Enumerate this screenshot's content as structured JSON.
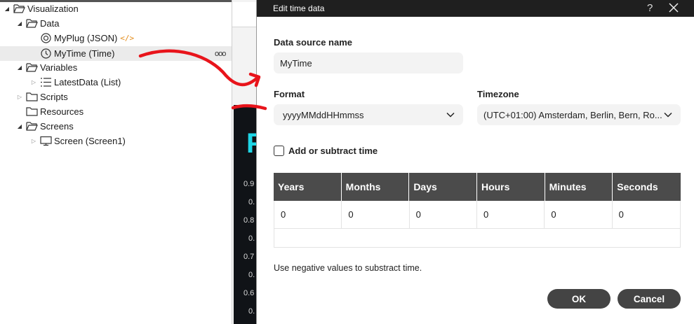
{
  "tree": {
    "root": "Visualization",
    "data": "Data",
    "myplug": "MyPlug (JSON)",
    "myplug_tag": "</>",
    "mytime": "MyTime (Time)",
    "more": "ooo",
    "variables": "Variables",
    "latestdata": "LatestData (List)",
    "scripts": "Scripts",
    "resources": "Resources",
    "screens": "Screens",
    "screen1": "Screen (Screen1)"
  },
  "background": {
    "ticks": [
      "0.9",
      "0.",
      "0.8",
      "0.",
      "0.7",
      "0.",
      "0.6",
      "0."
    ]
  },
  "dialog": {
    "title": "Edit time data",
    "help": "?",
    "source_label": "Data source name",
    "source_value": "MyTime",
    "format_label": "Format",
    "format_value": "yyyyMMddHHmmss",
    "timezone_label": "Timezone",
    "timezone_value": "(UTC+01:00) Amsterdam, Berlin, Bern, Ro...",
    "checkbox_label": "Add or subtract time",
    "checkbox_checked": false,
    "columns": [
      "Years",
      "Months",
      "Days",
      "Hours",
      "Minutes",
      "Seconds"
    ],
    "rows": [
      [
        "0",
        "0",
        "0",
        "0",
        "0",
        "0"
      ]
    ],
    "hint": "Use negative values to substract time.",
    "ok": "OK",
    "cancel": "Cancel"
  },
  "colors": {
    "titlebar": "#1f1f1f",
    "header": "#4b4b4b",
    "button": "#444444",
    "annotation": "#e8141b",
    "cyan": "#1fd6e6"
  }
}
